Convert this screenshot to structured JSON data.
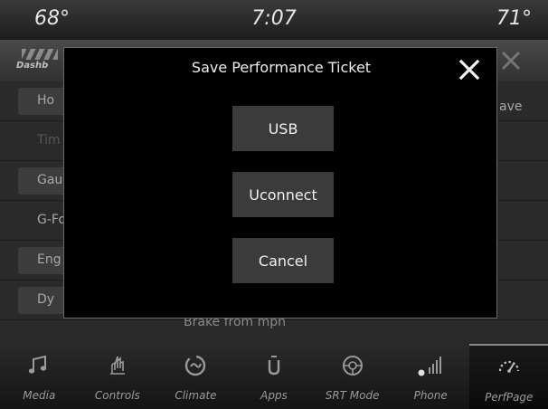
{
  "status": {
    "temp_left": "68°",
    "clock": "7:07",
    "temp_right": "71°"
  },
  "background": {
    "logo_text": "Dashb",
    "rows": [
      "Ho",
      "Tim",
      "Gau",
      "G-Fo",
      "Eng",
      "Dy"
    ],
    "right_label": "ave",
    "brake_text": "Brake from mph"
  },
  "modal": {
    "title": "Save Performance Ticket",
    "buttons": {
      "usb": "USB",
      "uconnect": "Uconnect",
      "cancel": "Cancel"
    }
  },
  "nav": {
    "items": [
      {
        "label": "Media",
        "icon": "music-note-icon"
      },
      {
        "label": "Controls",
        "icon": "hand-controls-icon"
      },
      {
        "label": "Climate",
        "icon": "climate-icon"
      },
      {
        "label": "Apps",
        "icon": "apps-icon"
      },
      {
        "label": "SRT Mode",
        "icon": "steering-wheel-icon"
      },
      {
        "label": "Phone",
        "icon": "phone-signal-icon"
      },
      {
        "label": "PerfPage",
        "icon": "gauge-icon"
      }
    ],
    "active": "PerfPage"
  }
}
